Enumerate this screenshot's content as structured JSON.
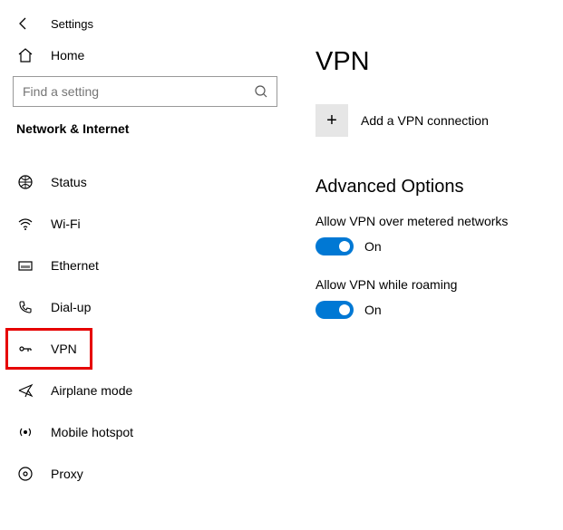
{
  "header": {
    "title": "Settings"
  },
  "sidebar": {
    "home_label": "Home",
    "search_placeholder": "Find a setting",
    "section_title": "Network & Internet",
    "items": [
      {
        "label": "Status"
      },
      {
        "label": "Wi-Fi"
      },
      {
        "label": "Ethernet"
      },
      {
        "label": "Dial-up"
      },
      {
        "label": "VPN"
      },
      {
        "label": "Airplane mode"
      },
      {
        "label": "Mobile hotspot"
      },
      {
        "label": "Proxy"
      }
    ]
  },
  "main": {
    "title": "VPN",
    "add_label": "Add a VPN connection",
    "advanced_title": "Advanced Options",
    "opt1_label": "Allow VPN over metered networks",
    "opt1_state": "On",
    "opt2_label": "Allow VPN while roaming",
    "opt2_state": "On"
  }
}
